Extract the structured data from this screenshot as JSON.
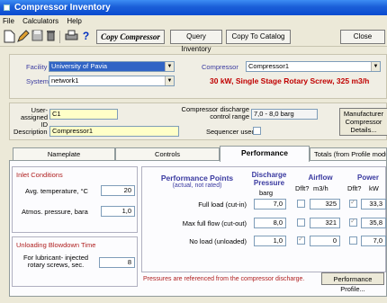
{
  "window": {
    "title": "Compressor Inventory"
  },
  "menu": [
    "File",
    "Calculators",
    "Help"
  ],
  "toolbar": {
    "copy_compressor": "Copy Compressor",
    "query_inventory": "Query Inventory",
    "copy_to_catalog": "Copy To Catalog",
    "close": "Close"
  },
  "top": {
    "facility_label": "Facility",
    "facility_value": "University of Pavia",
    "system_label": "System",
    "system_value": "network1",
    "compressor_label": "Compressor",
    "compressor_value": "Compressor1",
    "summary": "30 kW, Single Stage Rotary Screw, 325 m3/h"
  },
  "ident": {
    "user_id_label": "User-assigned ID",
    "user_id_value": "C1",
    "description_label": "Description",
    "description_value": "Compressor1",
    "discharge_label": "Compressor discharge control range",
    "discharge_value": "7,0 - 8,0 barg",
    "sequencer_label": "Sequencer used",
    "manufacturer_button": "Manufacturer Compressor Details..."
  },
  "tabs": [
    {
      "label": "Nameplate"
    },
    {
      "label": "Controls"
    },
    {
      "label": "Performance"
    },
    {
      "label": "Totals (from Profile module"
    }
  ],
  "inlet": {
    "heading": "Inlet Conditions",
    "temp_label": "Avg. temperature, °C",
    "temp_value": "20",
    "pressure_label": "Atmos. pressure, bara",
    "pressure_value": "1,0"
  },
  "unloading": {
    "heading": "Unloading Blowdown Time",
    "label": "For lubricant- injected rotary screws, sec.",
    "value": "8"
  },
  "performance": {
    "title": "Performance Points",
    "subtitle": "(actual, not rated)",
    "discharge_header": "Discharge Pressure",
    "discharge_unit": "barg",
    "airflow_header": "Airflow",
    "airflow_dflt": "Dflt?",
    "airflow_unit": "m3/h",
    "power_header": "Power",
    "power_dflt": "Dflt?",
    "power_unit": "kW",
    "rows": [
      {
        "label": "Full load (cut-in)",
        "pressure": "7,0",
        "airflow": "325",
        "power": "33,3"
      },
      {
        "label": "Max full flow (cut-out)",
        "pressure": "8,0",
        "airflow": "321",
        "power": "35,8"
      },
      {
        "label": "No load (unloaded)",
        "pressure": "1,0",
        "airflow": "0",
        "power": "7,0"
      }
    ],
    "footnote": "Pressures are referenced from the compressor discharge.",
    "profile_button": "Performance Profile..."
  }
}
